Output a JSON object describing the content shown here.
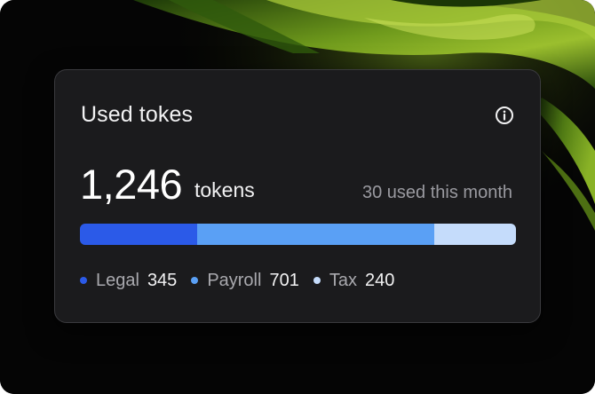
{
  "card": {
    "title": "Used tokes",
    "info_icon": "info-icon",
    "total_value": "1,246",
    "total_unit": "tokens",
    "month_note": "30 used this month"
  },
  "usage": {
    "total": 1246,
    "segments": [
      {
        "label": "Legal",
        "value": "345",
        "amount": 345,
        "color": "#2b5ae8"
      },
      {
        "label": "Payroll",
        "value": "701",
        "amount": 701,
        "color": "#5aa0f5"
      },
      {
        "label": "Tax",
        "value": "240",
        "amount": 240,
        "color": "#c5dcfb"
      }
    ]
  },
  "colors": {
    "card_bg": "#1b1b1d",
    "card_border": "#3a3a3e",
    "muted_text": "#9a9aa0"
  }
}
